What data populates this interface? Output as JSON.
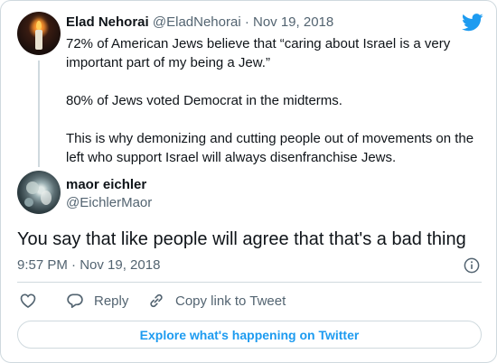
{
  "parent_tweet": {
    "author_name": "Elad Nehorai",
    "meta": "@EladNehorai · Nov 19, 2018",
    "text": "72% of American Jews believe that “caring about Israel is a very important part of my being a Jew.”\n\n80% of Jews voted Democrat in the midterms.\n\nThis is why demonizing and cutting people out of movements on the left who support Israel will always disenfranchise Jews."
  },
  "reply_tweet": {
    "author_name": "maor eichler",
    "handle": "@EichlerMaor",
    "text": "You say that like people will agree that that's a bad thing",
    "timestamp": "9:57 PM · Nov 19, 2018"
  },
  "actions": {
    "reply_label": "Reply",
    "copy_link_label": "Copy link to Tweet"
  },
  "explore_label": "Explore what's happening on Twitter",
  "colors": {
    "twitter_blue": "#1d9bf0",
    "secondary_text": "#536471",
    "border": "#cfd9de"
  },
  "icons": [
    "twitter-bird-icon",
    "info-icon",
    "heart-icon",
    "reply-icon",
    "link-icon"
  ]
}
